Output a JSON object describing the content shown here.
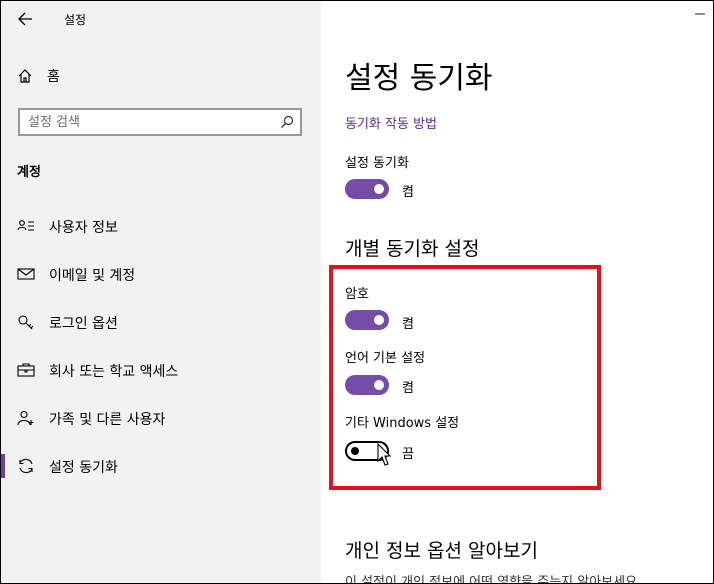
{
  "window": {
    "title": "설정"
  },
  "sidebar": {
    "home_label": "홈",
    "search_placeholder": "설정 검색",
    "section_title": "계정",
    "items": [
      {
        "label": "사용자 정보",
        "icon": "user-card-icon"
      },
      {
        "label": "이메일 및 계정",
        "icon": "mail-icon"
      },
      {
        "label": "로그인 옵션",
        "icon": "key-icon"
      },
      {
        "label": "회사 또는 학교 액세스",
        "icon": "briefcase-icon"
      },
      {
        "label": "가족 및 다른 사용자",
        "icon": "person-add-icon"
      },
      {
        "label": "설정 동기화",
        "icon": "sync-icon",
        "active": true
      }
    ]
  },
  "main": {
    "title": "설정 동기화",
    "how_link": "동기화 작동 방법",
    "sync_settings": {
      "label": "설정 동기화",
      "state": "켬",
      "on": true
    },
    "individual_title": "개별 동기화 설정",
    "individual": [
      {
        "label": "암호",
        "state": "켬",
        "on": true
      },
      {
        "label": "언어 기본 설정",
        "state": "켬",
        "on": true
      },
      {
        "label": "기타 Windows 설정",
        "state": "끔",
        "on": false
      }
    ],
    "privacy_title": "개인 정보 옵션 알아보기",
    "privacy_desc": "이 설정이 개인 정보에 어떤 영향을 주는지 알아보세요"
  },
  "colors": {
    "accent": "#744da9",
    "link": "#5a2e8f",
    "highlight": "#e0121f",
    "sidebar_bg": "#f2f2f2"
  }
}
